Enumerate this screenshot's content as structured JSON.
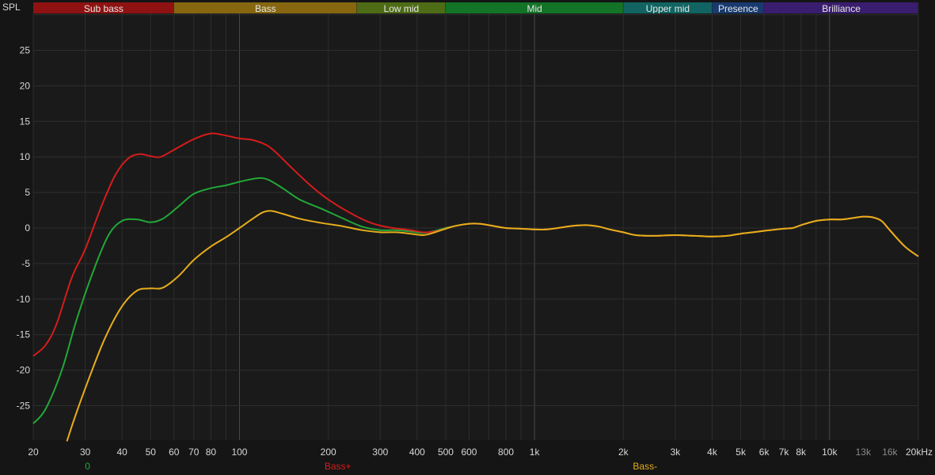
{
  "chart_data": {
    "type": "line",
    "y_axis_label": "SPL",
    "x_unit": "Hz",
    "x_scale": "log",
    "xlim": [
      20,
      20000
    ],
    "ylim": [
      -30,
      30
    ],
    "grid": true,
    "bands": [
      {
        "name": "Sub bass",
        "from": 20,
        "to": 60,
        "color": "#8f1212"
      },
      {
        "name": "Bass",
        "from": 60,
        "to": 250,
        "color": "#86670f"
      },
      {
        "name": "Low mid",
        "from": 250,
        "to": 500,
        "color": "#4e6c16"
      },
      {
        "name": "Mid",
        "from": 500,
        "to": 2000,
        "color": "#137326"
      },
      {
        "name": "Upper mid",
        "from": 2000,
        "to": 4000,
        "color": "#116461"
      },
      {
        "name": "Presence",
        "from": 4000,
        "to": 6000,
        "color": "#183a6e"
      },
      {
        "name": "Brilliance",
        "from": 6000,
        "to": 20000,
        "color": "#3a1d6e"
      }
    ],
    "y_ticks": [
      25,
      20,
      15,
      10,
      5,
      0,
      -5,
      -10,
      -15,
      -20,
      -25
    ],
    "x_ticks": [
      {
        "label": "20",
        "value": 20
      },
      {
        "label": "30",
        "value": 30
      },
      {
        "label": "40",
        "value": 40
      },
      {
        "label": "50",
        "value": 50
      },
      {
        "label": "60",
        "value": 60
      },
      {
        "label": "70",
        "value": 70
      },
      {
        "label": "80",
        "value": 80
      },
      {
        "label": "100",
        "value": 100
      },
      {
        "label": "200",
        "value": 200
      },
      {
        "label": "300",
        "value": 300
      },
      {
        "label": "400",
        "value": 400
      },
      {
        "label": "500",
        "value": 500
      },
      {
        "label": "600",
        "value": 600
      },
      {
        "label": "800",
        "value": 800
      },
      {
        "label": "1k",
        "value": 1000
      },
      {
        "label": "2k",
        "value": 2000
      },
      {
        "label": "3k",
        "value": 3000
      },
      {
        "label": "4k",
        "value": 4000
      },
      {
        "label": "5k",
        "value": 5000
      },
      {
        "label": "6k",
        "value": 6000
      },
      {
        "label": "7k",
        "value": 7000
      },
      {
        "label": "8k",
        "value": 8000
      },
      {
        "label": "10k",
        "value": 10000
      },
      {
        "label": "13k",
        "value": 13000,
        "dim": true
      },
      {
        "label": "16k",
        "value": 16000,
        "dim": true
      },
      {
        "label": "20kHz",
        "value": 20000
      }
    ],
    "series": [
      {
        "name": "0",
        "color": "#22a838",
        "points": [
          [
            20,
            -27.5
          ],
          [
            22,
            -25.5
          ],
          [
            25,
            -20
          ],
          [
            28,
            -13
          ],
          [
            32,
            -6
          ],
          [
            36,
            -1
          ],
          [
            40,
            1
          ],
          [
            45,
            1.2
          ],
          [
            50,
            0.8
          ],
          [
            55,
            1.3
          ],
          [
            62,
            3
          ],
          [
            70,
            4.8
          ],
          [
            80,
            5.6
          ],
          [
            90,
            6
          ],
          [
            100,
            6.5
          ],
          [
            115,
            7
          ],
          [
            125,
            6.8
          ],
          [
            140,
            5.6
          ],
          [
            160,
            4
          ],
          [
            190,
            2.7
          ],
          [
            220,
            1.5
          ],
          [
            260,
            0.2
          ],
          [
            300,
            -0.3
          ],
          [
            340,
            -0.3
          ],
          [
            380,
            -0.5
          ],
          [
            420,
            -0.7
          ],
          [
            460,
            -0.4
          ],
          [
            500,
            0
          ],
          [
            540,
            0.3
          ],
          [
            600,
            0.6
          ],
          [
            650,
            0.6
          ],
          [
            700,
            0.4
          ],
          [
            800,
            0
          ],
          [
            900,
            -0.1
          ],
          [
            1000,
            -0.2
          ],
          [
            1100,
            -0.2
          ],
          [
            1200,
            0
          ],
          [
            1350,
            0.3
          ],
          [
            1500,
            0.4
          ],
          [
            1650,
            0.2
          ],
          [
            1800,
            -0.2
          ],
          [
            2000,
            -0.6
          ],
          [
            2200,
            -1
          ],
          [
            2500,
            -1.1
          ],
          [
            3000,
            -1
          ],
          [
            3500,
            -1.1
          ],
          [
            4000,
            -1.2
          ],
          [
            4500,
            -1.1
          ],
          [
            5000,
            -0.8
          ],
          [
            5500,
            -0.6
          ],
          [
            6000,
            -0.4
          ],
          [
            7000,
            -0.1
          ],
          [
            7500,
            0
          ],
          [
            8000,
            0.4
          ],
          [
            9000,
            1
          ],
          [
            10000,
            1.2
          ],
          [
            11000,
            1.2
          ],
          [
            12000,
            1.4
          ],
          [
            13000,
            1.6
          ],
          [
            14000,
            1.5
          ],
          [
            15000,
            1
          ],
          [
            16000,
            -0.3
          ],
          [
            18000,
            -2.6
          ],
          [
            20000,
            -4
          ]
        ]
      },
      {
        "name": "Bass+",
        "color": "#d61c1c",
        "points": [
          [
            20,
            -18
          ],
          [
            22,
            -16.5
          ],
          [
            24,
            -13.5
          ],
          [
            27,
            -7
          ],
          [
            30,
            -3
          ],
          [
            34,
            3
          ],
          [
            38,
            7.5
          ],
          [
            42,
            9.8
          ],
          [
            46,
            10.4
          ],
          [
            50,
            10.1
          ],
          [
            54,
            10
          ],
          [
            60,
            11
          ],
          [
            70,
            12.5
          ],
          [
            80,
            13.3
          ],
          [
            90,
            13
          ],
          [
            100,
            12.6
          ],
          [
            110,
            12.4
          ],
          [
            120,
            11.9
          ],
          [
            130,
            11
          ],
          [
            150,
            8.5
          ],
          [
            175,
            5.9
          ],
          [
            200,
            4
          ],
          [
            240,
            2
          ],
          [
            280,
            0.7
          ],
          [
            320,
            0.1
          ],
          [
            380,
            -0.3
          ],
          [
            420,
            -0.6
          ],
          [
            460,
            -0.5
          ],
          [
            500,
            -0.1
          ],
          [
            540,
            0.3
          ],
          [
            600,
            0.6
          ],
          [
            650,
            0.6
          ],
          [
            700,
            0.4
          ],
          [
            800,
            0
          ],
          [
            900,
            -0.1
          ],
          [
            1000,
            -0.2
          ],
          [
            1100,
            -0.2
          ],
          [
            1200,
            0
          ],
          [
            1350,
            0.3
          ],
          [
            1500,
            0.4
          ],
          [
            1650,
            0.2
          ],
          [
            1800,
            -0.2
          ],
          [
            2000,
            -0.6
          ],
          [
            2200,
            -1
          ],
          [
            2500,
            -1.1
          ],
          [
            3000,
            -1
          ],
          [
            3500,
            -1.1
          ],
          [
            4000,
            -1.2
          ],
          [
            4500,
            -1.1
          ],
          [
            5000,
            -0.8
          ],
          [
            5500,
            -0.6
          ],
          [
            6000,
            -0.4
          ],
          [
            7000,
            -0.1
          ],
          [
            7500,
            0
          ],
          [
            8000,
            0.4
          ],
          [
            9000,
            1
          ],
          [
            10000,
            1.2
          ],
          [
            11000,
            1.2
          ],
          [
            12000,
            1.4
          ],
          [
            13000,
            1.6
          ],
          [
            14000,
            1.5
          ],
          [
            15000,
            1
          ],
          [
            16000,
            -0.3
          ],
          [
            18000,
            -2.6
          ],
          [
            20000,
            -4
          ]
        ]
      },
      {
        "name": "Bass-",
        "color": "#e6ad1c",
        "points": [
          [
            26,
            -30
          ],
          [
            28,
            -26
          ],
          [
            31,
            -21
          ],
          [
            35,
            -15.5
          ],
          [
            40,
            -11
          ],
          [
            45,
            -8.8
          ],
          [
            50,
            -8.5
          ],
          [
            55,
            -8.4
          ],
          [
            62,
            -6.8
          ],
          [
            70,
            -4.5
          ],
          [
            80,
            -2.6
          ],
          [
            90,
            -1.3
          ],
          [
            100,
            0
          ],
          [
            110,
            1.2
          ],
          [
            120,
            2.2
          ],
          [
            128,
            2.4
          ],
          [
            140,
            2
          ],
          [
            160,
            1.3
          ],
          [
            190,
            0.7
          ],
          [
            220,
            0.3
          ],
          [
            260,
            -0.3
          ],
          [
            300,
            -0.6
          ],
          [
            340,
            -0.6
          ],
          [
            380,
            -0.8
          ],
          [
            420,
            -1
          ],
          [
            460,
            -0.6
          ],
          [
            500,
            -0.1
          ],
          [
            540,
            0.3
          ],
          [
            600,
            0.6
          ],
          [
            650,
            0.6
          ],
          [
            700,
            0.4
          ],
          [
            800,
            0
          ],
          [
            900,
            -0.1
          ],
          [
            1000,
            -0.2
          ],
          [
            1100,
            -0.2
          ],
          [
            1200,
            0
          ],
          [
            1350,
            0.3
          ],
          [
            1500,
            0.4
          ],
          [
            1650,
            0.2
          ],
          [
            1800,
            -0.2
          ],
          [
            2000,
            -0.6
          ],
          [
            2200,
            -1
          ],
          [
            2500,
            -1.1
          ],
          [
            3000,
            -1
          ],
          [
            3500,
            -1.1
          ],
          [
            4000,
            -1.2
          ],
          [
            4500,
            -1.1
          ],
          [
            5000,
            -0.8
          ],
          [
            5500,
            -0.6
          ],
          [
            6000,
            -0.4
          ],
          [
            7000,
            -0.1
          ],
          [
            7500,
            0
          ],
          [
            8000,
            0.4
          ],
          [
            9000,
            1
          ],
          [
            10000,
            1.2
          ],
          [
            11000,
            1.2
          ],
          [
            12000,
            1.4
          ],
          [
            13000,
            1.6
          ],
          [
            14000,
            1.5
          ],
          [
            15000,
            1
          ],
          [
            16000,
            -0.3
          ],
          [
            18000,
            -2.6
          ],
          [
            20000,
            -4
          ]
        ]
      }
    ],
    "legend": [
      {
        "label": "0",
        "color": "#22a838",
        "position_hz": 30
      },
      {
        "label": "Bass+",
        "color": "#d61c1c",
        "position_hz": 200
      },
      {
        "label": "Bass-",
        "color": "#e6ad1c",
        "position_hz": 2200
      }
    ]
  }
}
